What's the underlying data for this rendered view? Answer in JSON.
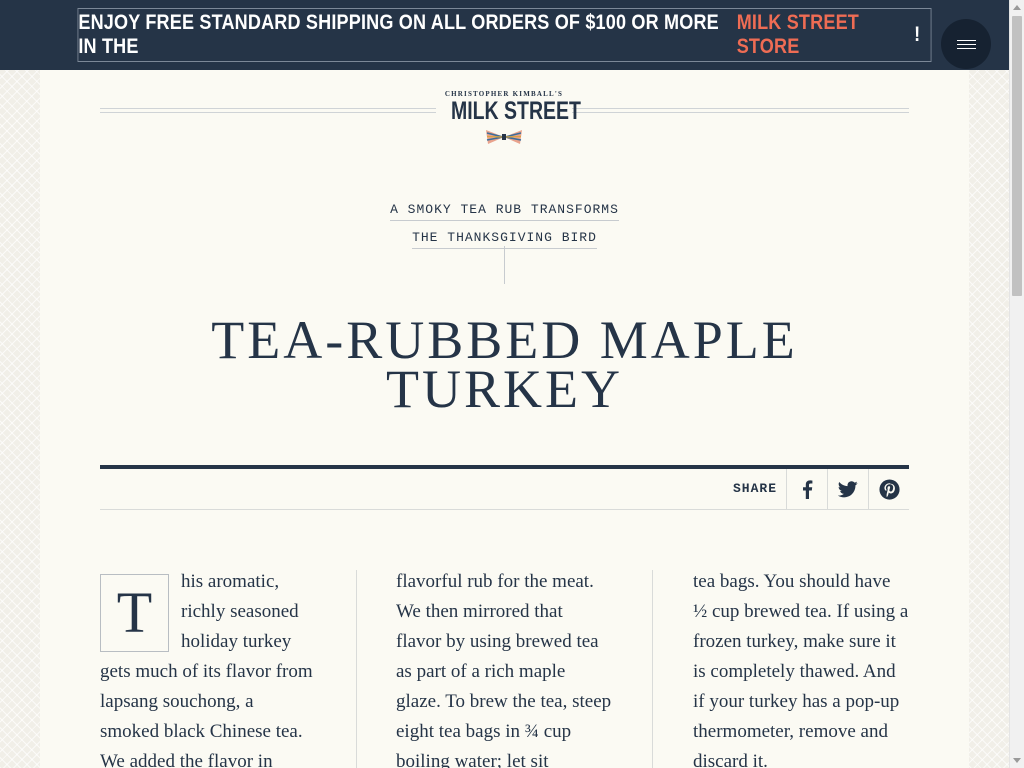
{
  "promo": {
    "text": "ENJOY FREE STANDARD SHIPPING ON ALL ORDERS OF $100 OR MORE IN THE ",
    "link": "MILK STREET STORE",
    "suffix": "!"
  },
  "menu": {
    "icon": "hamburger-menu-icon"
  },
  "logo": {
    "small": "CHRISTOPHER KIMBALL'S",
    "name": "MILK STREET",
    "mark": "bowtie-logo-icon"
  },
  "kicker": {
    "line1": "A SMOKY TEA RUB TRANSFORMS",
    "line2": "THE THANKSGIVING BIRD"
  },
  "title": {
    "line1": "TEA-RUBBED MAPLE",
    "line2": "TURKEY"
  },
  "share": {
    "label": "SHARE",
    "buttons": [
      {
        "name": "facebook",
        "icon": "facebook-icon"
      },
      {
        "name": "twitter",
        "icon": "twitter-icon"
      },
      {
        "name": "pinterest",
        "icon": "pinterest-icon"
      }
    ]
  },
  "article": {
    "dropcap": "T",
    "col1": "his aromatic, richly seasoned holiday turkey gets much of its flavor from lapsang souchong, a smoked black Chinese tea. We added the flavor in",
    "col2": "flavorful rub for the meat. We then mirrored that flavor by using brewed tea as part of a rich maple glaze. To brew the tea, steep eight tea bags in ¾ cup boiling water; let sit",
    "col3": "tea bags. You should have ½ cup brewed tea. If using a frozen turkey, make sure it is completely thawed. And if your turkey has a pop-up thermometer, remove and discard it."
  },
  "colors": {
    "navy": "#253447",
    "accent": "#ee6c54",
    "paper": "#fbfaf3"
  }
}
